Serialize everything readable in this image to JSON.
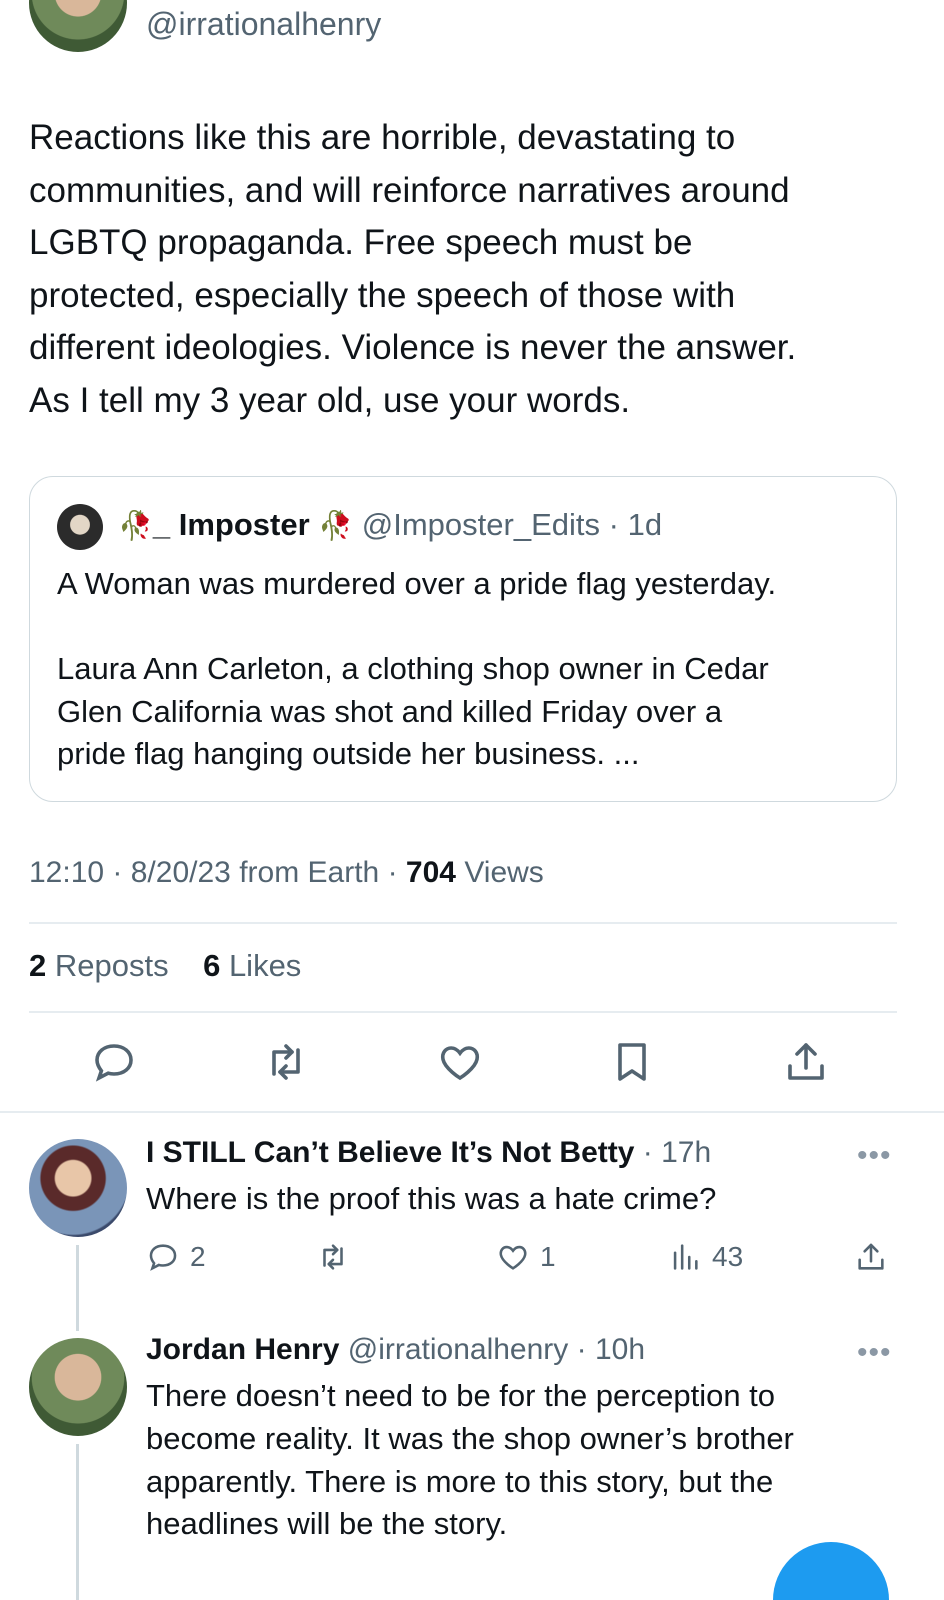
{
  "tweet": {
    "handle": "@irrationalhenry",
    "text_lines": [
      "Reactions like this are horrible, devastating to",
      "communities, and will reinforce narratives around",
      "LGBTQ propaganda. Free speech must be",
      "protected, especially the speech of those with",
      "different ideologies. Violence is never the answer.",
      "As I tell my 3 year old, use your words."
    ],
    "time": "12:10",
    "date": "8/20/23",
    "source": "from Earth",
    "views_count": "704",
    "views_label": "Views",
    "reposts_count": "2",
    "reposts_label": "Reposts",
    "likes_count": "6",
    "likes_label": "Likes"
  },
  "quote": {
    "name": "_ Imposter",
    "handle": "@Imposter_Edits",
    "age": "1d",
    "emoji": "🥀",
    "line1": "A Woman was murdered over a pride flag yesterday.",
    "body_lines": [
      "Laura Ann Carleton, a clothing shop owner in Cedar",
      "Glen California was shot and killed Friday over a",
      "pride flag hanging outside her business. ..."
    ]
  },
  "actions": [
    "reply-icon",
    "repost-icon",
    "like-icon",
    "bookmark-icon",
    "share-icon"
  ],
  "replies": [
    {
      "name": "I STILL Can’t Believe It’s Not Betty",
      "handle": "",
      "age": "17h",
      "more": "•••",
      "text_lines": [
        "Where is the proof this was a hate crime?"
      ],
      "reply_count": "2",
      "repost_count": "",
      "like_count": "1",
      "view_count": "43"
    },
    {
      "name": "Jordan Henry",
      "handle": "@irrationalhenry",
      "age": "10h",
      "more": "•••",
      "text_lines": [
        "There doesn’t need to be for the perception to",
        "become reality. It was the shop owner’s brother",
        "apparently. There is more to this story, but the",
        "headlines will be the story."
      ]
    }
  ],
  "colors": {
    "accent": "#1d9bf0",
    "muted": "#536471",
    "border": "#cfd9de"
  }
}
